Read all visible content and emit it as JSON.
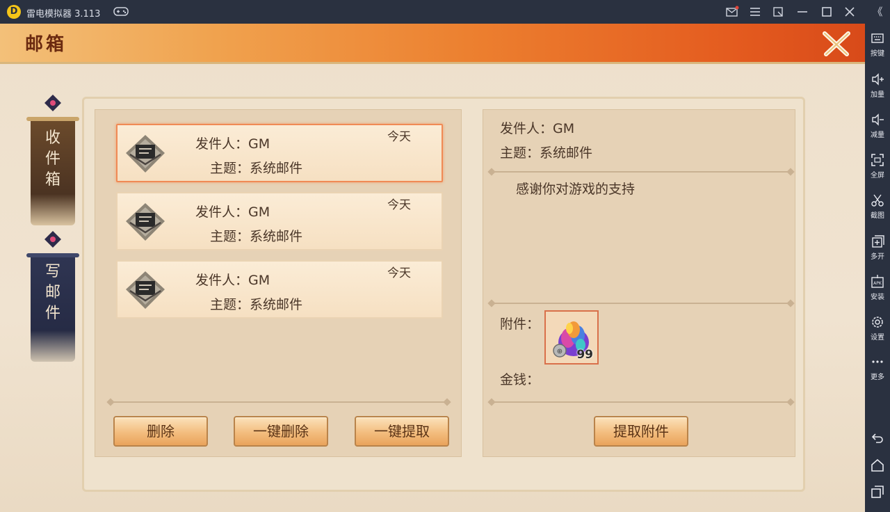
{
  "emulator": {
    "title": "雷电模拟器 3.113",
    "logo": "D",
    "window_buttons": [
      "mail-icon",
      "menu-icon",
      "restore-icon",
      "minimize-icon",
      "maximize-icon",
      "close-icon"
    ],
    "collapse_glyph": "《"
  },
  "sidebar": {
    "items": [
      {
        "label": "按键",
        "icon": "keyboard-icon"
      },
      {
        "label": "加量",
        "icon": "volume-up-icon"
      },
      {
        "label": "减量",
        "icon": "volume-down-icon"
      },
      {
        "label": "全屏",
        "icon": "fullscreen-icon"
      },
      {
        "label": "截图",
        "icon": "scissors-icon"
      },
      {
        "label": "多开",
        "icon": "multi-open-icon"
      },
      {
        "label": "安装",
        "icon": "apk-install-icon"
      },
      {
        "label": "设置",
        "icon": "gear-icon"
      },
      {
        "label": "更多",
        "icon": "more-icon"
      }
    ],
    "nav": [
      "back-icon",
      "home-icon",
      "recent-apps-icon"
    ]
  },
  "game": {
    "header_title": "邮箱",
    "tabs": [
      {
        "label": [
          "收",
          "件",
          "箱"
        ],
        "active": true
      },
      {
        "label": [
          "写",
          "邮",
          "件"
        ],
        "active": false
      }
    ],
    "mails": [
      {
        "sender": "发件人：GM",
        "subject": "主题：系统邮件",
        "date": "今天",
        "selected": true
      },
      {
        "sender": "发件人：GM",
        "subject": "主题：系统邮件",
        "date": "今天",
        "selected": false
      },
      {
        "sender": "发件人：GM",
        "subject": "主题：系统邮件",
        "date": "今天",
        "selected": false
      }
    ],
    "list_buttons": {
      "delete": "删除",
      "delete_all": "一键删除",
      "claim_all": "一键提取"
    },
    "detail": {
      "sender": "发件人：GM",
      "subject": "主题：系统邮件",
      "body": "感谢你对游戏的支持",
      "attachment_label": "附件：",
      "attachment_count": "99",
      "money_label": "金钱：",
      "claim_button": "提取附件"
    },
    "colors": {
      "header_orange": "#ec7f2f",
      "selected_border": "#f08a55",
      "button_gold": "#f3bd7e"
    }
  }
}
